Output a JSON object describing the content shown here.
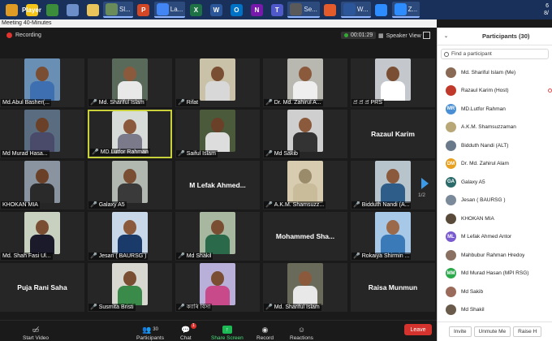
{
  "taskbar": {
    "items": [
      {
        "label": "",
        "icon": "app-icon",
        "color": "#e09b25"
      },
      {
        "label": "",
        "icon": "player-icon",
        "color": "#f5c518",
        "text": "Player"
      },
      {
        "label": "",
        "icon": "windows-apps-icon",
        "color": "#3b8d3b"
      },
      {
        "label": "",
        "icon": "paint-icon",
        "color": "#6c8fc9"
      },
      {
        "label": "",
        "icon": "folder-icon",
        "color": "#e8c45a"
      },
      {
        "label": "Sl...",
        "icon": "screenshot-icon",
        "color": "#6a8c5a"
      },
      {
        "label": "",
        "icon": "powerpoint-icon",
        "color": "#d24726",
        "text": "P"
      },
      {
        "label": "La...",
        "icon": "chrome-icon",
        "color": "#4285f4"
      },
      {
        "label": "",
        "icon": "excel-icon",
        "color": "#1e7145",
        "text": "X"
      },
      {
        "label": "",
        "icon": "word-icon",
        "color": "#2b579a",
        "text": "W"
      },
      {
        "label": "",
        "icon": "outlook-icon",
        "color": "#0072c6",
        "text": "O"
      },
      {
        "label": "",
        "icon": "onenote-icon",
        "color": "#7719aa",
        "text": "N"
      },
      {
        "label": "",
        "icon": "teams-icon",
        "color": "#5059c9",
        "text": "T"
      },
      {
        "label": "Se...",
        "icon": "settings-icon",
        "color": "#5a5a5a"
      },
      {
        "label": "",
        "icon": "location-icon",
        "color": "#e35a2b"
      },
      {
        "label": "W...",
        "icon": "word-doc-icon",
        "color": "#2b579a"
      },
      {
        "label": "",
        "icon": "zoom-icon",
        "color": "#2d8cff"
      },
      {
        "label": "Z...",
        "icon": "zoom-meeting-icon",
        "color": "#2d8cff"
      }
    ],
    "clock": "6",
    "date": "8/"
  },
  "meeting": {
    "title": "Meeting 40-Minutes",
    "recording_label": "Recording",
    "timer": "00:01:29",
    "speaker_view_label": "Speaker View",
    "page_indicator": "1/2"
  },
  "tiles": [
    {
      "name": "Md.Abul Basher(...",
      "muted": false,
      "skin": "#7a4e33",
      "shirt": "#3e6fb0",
      "bg": "#6a8fb5"
    },
    {
      "name": "Md. Shariful Islam",
      "muted": true,
      "skin": "#8b5a3c",
      "shirt": "#e8e8e8",
      "bg": "#5a6a5a"
    },
    {
      "name": "Rifat",
      "muted": true,
      "skin": "#7a4e33",
      "shirt": "#d8d8d8",
      "bg": "#c9c2a8"
    },
    {
      "name": "Dr. Md. Zahirul A...",
      "muted": true,
      "skin": "#8b5a3c",
      "shirt": "#eeeeee",
      "bg": "#b8b8b0"
    },
    {
      "name": "প্ৰ প্ৰ প্ৰ PRS",
      "muted": false,
      "skin": "#7a4e33",
      "shirt": "#ffffff",
      "bg": "#c4c8cc"
    },
    {
      "name": "Md Murad Hasa...",
      "muted": false,
      "skin": "#6a4028",
      "shirt": "#4a4a6a",
      "bg": "#5a6d80"
    },
    {
      "name": "MD.Lutfor Rahman",
      "muted": true,
      "skin": "#8b5a3c",
      "shirt": "#7a7a8a",
      "bg": "#d8dcd8",
      "active": true
    },
    {
      "name": "Saiful Islam",
      "muted": true,
      "skin": "#6a4028",
      "shirt": "#dddddd",
      "bg": "#4a5a3a"
    },
    {
      "name": "Md Sakib",
      "muted": true,
      "skin": "#8b5a3c",
      "shirt": "#333333",
      "bg": "#cfcfcf"
    },
    {
      "name": "Razaul Karim",
      "muted": false,
      "noVideo": true
    },
    {
      "name": "KHOKAN MIA",
      "muted": false,
      "skin": "#6a4028",
      "shirt": "#2a2a2a",
      "bg": "#8a94a0"
    },
    {
      "name": "Galaxy A5",
      "muted": true,
      "skin": "#7a4e33",
      "shirt": "#3a3a3a",
      "bg": "#b0b8b0"
    },
    {
      "name": "M Lefak Ahmed...",
      "muted": false,
      "noVideo": true
    },
    {
      "name": "A.K.M. Shamsuzz...",
      "muted": true,
      "skin": "#9a8c6a",
      "shirt": "#c8bc9a",
      "bg": "#d8ccb0"
    },
    {
      "name": "Bidduth Nandi (A...",
      "muted": true,
      "skin": "#8b5a3c",
      "shirt": "#2f5d8a",
      "bg": "#b8c4cc"
    },
    {
      "name": "Md. Shah Fasi Ul...",
      "muted": false,
      "skin": "#7a4e33",
      "shirt": "#1a1a2a",
      "bg": "#c8d0c0"
    },
    {
      "name": "Jesan ( BAURSG )",
      "muted": true,
      "skin": "#8b5a3c",
      "shirt": "#1a3a6a",
      "bg": "#c8d8e8"
    },
    {
      "name": "Md Shakil",
      "muted": true,
      "skin": "#7a4e33",
      "shirt": "#2a6a4a",
      "bg": "#a8b8a0"
    },
    {
      "name": "Mohammed Sha...",
      "muted": false,
      "noVideo": true
    },
    {
      "name": "Rokaiya Shirmin ...",
      "muted": true,
      "skin": "#9a6a4a",
      "shirt": "#3a7ab8",
      "bg": "#a8c8e8"
    },
    {
      "name": "Puja Rani Saha",
      "muted": false,
      "noVideo": true
    },
    {
      "name": "Susmita Bristi",
      "muted": true,
      "skin": "#7a4e33",
      "shirt": "#3a8a4a",
      "bg": "#d8d8d0"
    },
    {
      "name": "ক্যাৰি বিসা",
      "muted": true,
      "skin": "#7a4e33",
      "shirt": "#c84a8a",
      "bg": "#b8b0d8"
    },
    {
      "name": "Md. Shariful Islam",
      "muted": true,
      "skin": "#8b5a3c",
      "shirt": "#e8e8e8",
      "bg": "#6a6a5a"
    },
    {
      "name": "Raisa Munmun",
      "muted": false,
      "noVideo": true
    }
  ],
  "toolbar": {
    "start_video": "Start Video",
    "participants": "Participants",
    "participants_count": "30",
    "chat": "Chat",
    "chat_badge": "1",
    "share_screen": "Share Screen",
    "record": "Record",
    "reactions": "Reactions",
    "leave": "Leave"
  },
  "panel": {
    "title": "Participants (30)",
    "search_placeholder": "Find a participant",
    "participants": [
      {
        "name": "Md. Shariful Islam (Me)",
        "initials": "",
        "color": "#8a6a55"
      },
      {
        "name": "Razaul Karim (Host)",
        "initials": "",
        "color": "#c0392b",
        "video": true
      },
      {
        "name": "MD.Lutfor Rahman",
        "initials": "MR",
        "color": "#4a8fd4"
      },
      {
        "name": "A.K.M. Shamsuzzaman",
        "initials": "",
        "color": "#b8a878"
      },
      {
        "name": "Bidduth Nandi (ALT)",
        "initials": "",
        "color": "#6a7a8a"
      },
      {
        "name": "Dr. Md. Zahirul Alam",
        "initials": "DM",
        "color": "#e8a020"
      },
      {
        "name": "Galaxy A5",
        "initials": "GA",
        "color": "#2a6a6a"
      },
      {
        "name": "Jesan ( BAURSG )",
        "initials": "",
        "color": "#7a8a9a"
      },
      {
        "name": "KHOKAN MIA",
        "initials": "",
        "color": "#5a4a3a"
      },
      {
        "name": "M Lefak Ahmed Antor",
        "initials": "ML",
        "color": "#7a5acf"
      },
      {
        "name": "Mahbubur Rahman Hredoy",
        "initials": "",
        "color": "#8a7060"
      },
      {
        "name": "Md Murad Hasan (MPI RSG)",
        "initials": "MM",
        "color": "#2aa84a"
      },
      {
        "name": "Md Sakib",
        "initials": "",
        "color": "#9a6a5a"
      },
      {
        "name": "Md Shakil",
        "initials": "",
        "color": "#6a5a4a"
      }
    ],
    "invite": "Invite",
    "unmute_me": "Unmute Me",
    "raise_hand": "Raise H"
  }
}
